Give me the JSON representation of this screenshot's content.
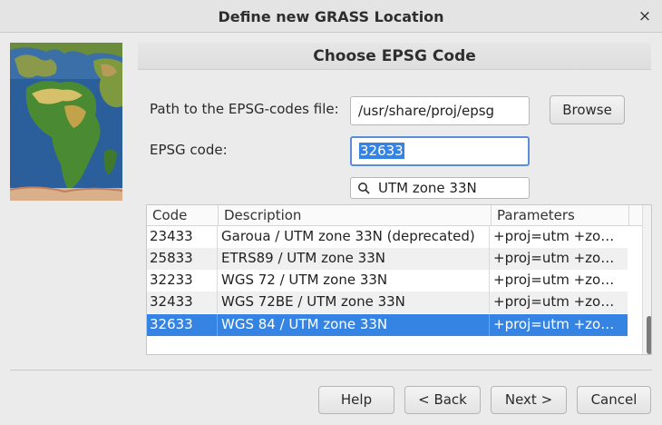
{
  "window": {
    "title": "Define new GRASS Location",
    "close_glyph": "×"
  },
  "page": {
    "heading": "Choose EPSG Code"
  },
  "form": {
    "path_label": "Path to the EPSG-codes file:",
    "path_value": "/usr/share/proj/epsg",
    "browse_label": "Browse",
    "code_label": "EPSG code:",
    "code_value": "32633",
    "search_value": "UTM zone 33N"
  },
  "table": {
    "columns": [
      "Code",
      "Description",
      "Parameters"
    ],
    "rows": [
      {
        "code": "23433",
        "description": "Garoua / UTM zone 33N (deprecated)",
        "params": "+proj=utm +zo…"
      },
      {
        "code": "25833",
        "description": "ETRS89 / UTM zone 33N",
        "params": "+proj=utm +zo…"
      },
      {
        "code": "32233",
        "description": "WGS 72 / UTM zone 33N",
        "params": "+proj=utm +zo…"
      },
      {
        "code": "32433",
        "description": "WGS 72BE / UTM zone 33N",
        "params": "+proj=utm +zo…"
      },
      {
        "code": "32633",
        "description": "WGS 84 / UTM zone 33N",
        "params": "+proj=utm +zo…"
      }
    ],
    "selected_row": 4
  },
  "footer": {
    "help_label": "Help",
    "back_label": "< Back",
    "next_label": "Next >",
    "cancel_label": "Cancel"
  },
  "colors": {
    "selection": "#3584e4",
    "focus_border": "#5b8ed6"
  },
  "icons": {
    "search": "search-icon",
    "close": "close-icon",
    "map": "world-map-image"
  }
}
